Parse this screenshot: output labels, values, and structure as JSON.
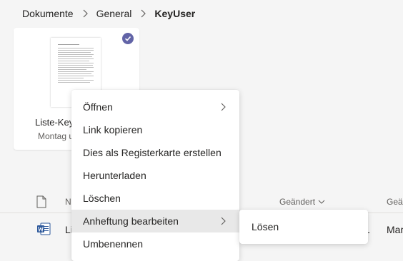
{
  "breadcrumb": {
    "items": [
      "Dokumente",
      "General"
    ],
    "current": "KeyUser"
  },
  "card": {
    "title": "Liste-Key",
    "subtitle": "Montag u"
  },
  "list_header": {
    "name": "N",
    "modified": "Geändert",
    "modified_by": "Geä"
  },
  "file_row": {
    "name": "Li",
    "date_fragment": "1",
    "author_fragment": "Mar"
  },
  "context_menu": {
    "items": [
      "Öffnen",
      "Link kopieren",
      "Dies als Registerkarte erstellen",
      "Herunterladen",
      "Löschen",
      "Anheftung bearbeiten",
      "Umbenennen"
    ]
  },
  "submenu": {
    "items": [
      "Lösen"
    ]
  },
  "colors": {
    "accent": "#6264a7",
    "word_blue": "#2b579a"
  },
  "icons": [
    "chevron-right-icon",
    "checkmark-icon",
    "document-icon",
    "word-file-icon",
    "chevron-down-icon"
  ]
}
